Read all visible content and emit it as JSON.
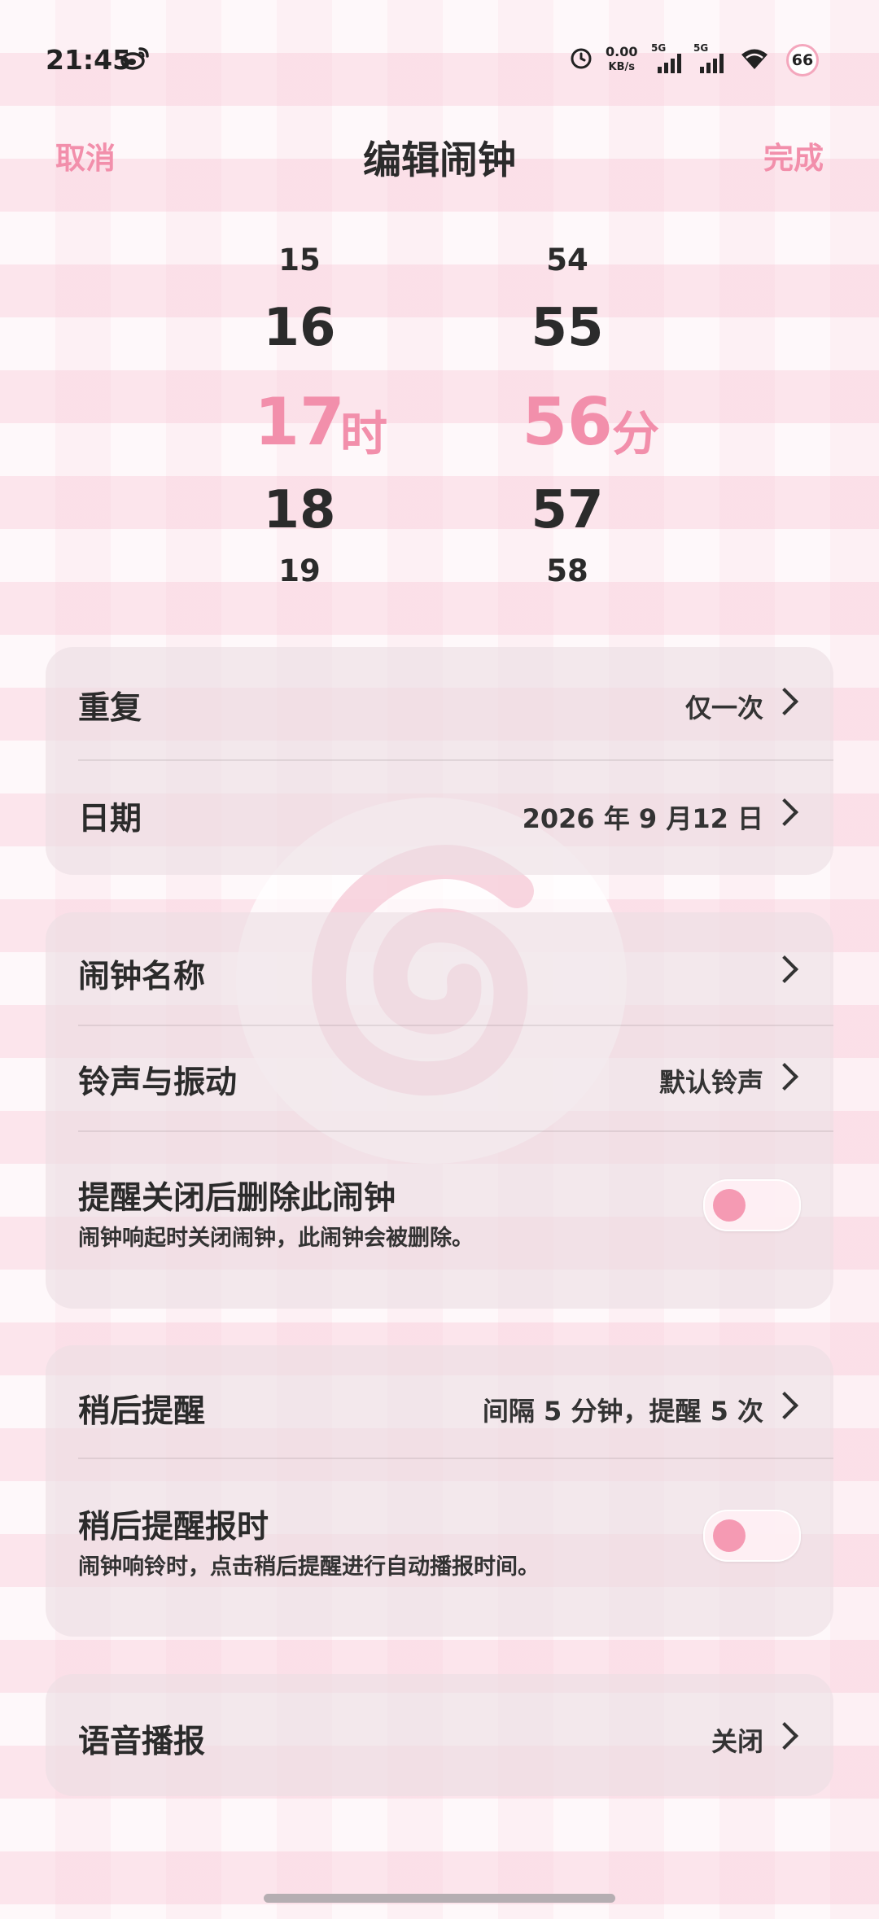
{
  "status_bar": {
    "time": "21:45",
    "net_speed_value": "0.00",
    "net_speed_unit": "KB/s",
    "sim1_label": "5G",
    "sim2_label": "5G",
    "battery": "66"
  },
  "nav": {
    "cancel": "取消",
    "title": "编辑闹钟",
    "done": "完成"
  },
  "picker": {
    "hours": [
      "15",
      "16",
      "17",
      "18",
      "19"
    ],
    "minutes": [
      "54",
      "55",
      "56",
      "57",
      "58"
    ],
    "hour_unit": "时",
    "minute_unit": "分"
  },
  "settings": {
    "repeat_label": "重复",
    "repeat_value": "仅一次",
    "date_label": "日期",
    "date_value": "2026 年 9 月12 日",
    "name_label": "闹钟名称",
    "ringtone_label": "铃声与振动",
    "ringtone_value": "默认铃声",
    "delete_label": "提醒关闭后删除此闹钟",
    "delete_desc": "闹钟响起时关闭闹钟，此闹钟会被删除。",
    "snooze_label": "稍后提醒",
    "snooze_value": "间隔 5 分钟，提醒 5 次",
    "snooze_announce_label": "稍后提醒报时",
    "snooze_announce_desc": "闹钟响铃时，点击稍后提醒进行自动播报时间。",
    "voice_label": "语音播报",
    "voice_value": "关闭"
  },
  "toggles": {
    "delete_after_dismiss": false,
    "snooze_announce": false
  },
  "colors": {
    "accent": "#f28fab",
    "background": "#fdf0f4",
    "card": "#ecdee4",
    "text": "#2b2b2b"
  },
  "icons": [
    "weibo-icon",
    "alarm-clock-icon",
    "signal-icon",
    "wifi-icon",
    "battery-icon",
    "chevron-right-icon",
    "swirl-decoration"
  ]
}
